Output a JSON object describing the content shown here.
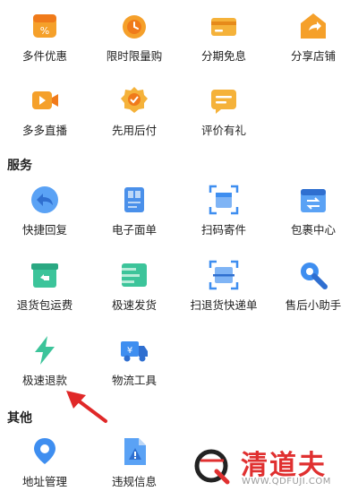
{
  "promo": {
    "items": [
      {
        "label": "多件优惠",
        "icon": "discount-bag-icon"
      },
      {
        "label": "限时限量购",
        "icon": "alarm-clock-icon"
      },
      {
        "label": "分期免息",
        "icon": "credit-card-icon"
      },
      {
        "label": "分享店铺",
        "icon": "share-store-icon"
      },
      {
        "label": "多多直播",
        "icon": "live-camera-icon"
      },
      {
        "label": "先用后付",
        "icon": "badge-check-icon"
      },
      {
        "label": "评价有礼",
        "icon": "review-gift-icon"
      }
    ]
  },
  "services": {
    "title": "服务",
    "items": [
      {
        "label": "快捷回复",
        "icon": "reply-icon"
      },
      {
        "label": "电子面单",
        "icon": "e-waybill-icon"
      },
      {
        "label": "扫码寄件",
        "icon": "scan-box-icon"
      },
      {
        "label": "包裹中心",
        "icon": "package-swap-icon"
      },
      {
        "label": "退货包运费",
        "icon": "return-box-icon"
      },
      {
        "label": "极速发货",
        "icon": "fast-ship-icon"
      },
      {
        "label": "扫退货快递单",
        "icon": "scan-return-icon"
      },
      {
        "label": "售后小助手",
        "icon": "wrench-icon"
      },
      {
        "label": "极速退款",
        "icon": "lightning-icon"
      },
      {
        "label": "物流工具",
        "icon": "delivery-truck-icon"
      }
    ]
  },
  "other": {
    "title": "其他",
    "items": [
      {
        "label": "地址管理",
        "icon": "location-pin-icon"
      },
      {
        "label": "违规信息",
        "icon": "warning-document-icon"
      }
    ]
  },
  "watermark": {
    "title": "清道夫",
    "url": "WWW.QDFUJI.COM"
  },
  "colors": {
    "orange": "#f5a02a",
    "blue": "#3e8ef0",
    "green": "#3cc49a",
    "red_arrow": "#e02828"
  }
}
